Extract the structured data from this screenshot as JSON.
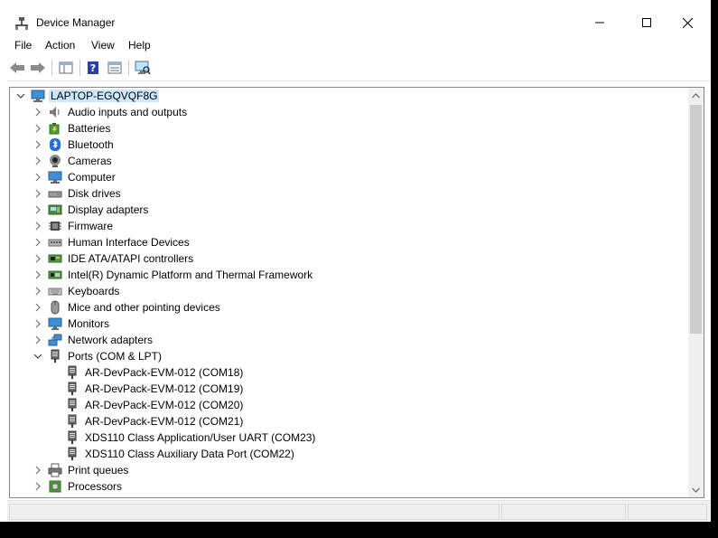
{
  "window": {
    "title": "Device Manager"
  },
  "menu": [
    "File",
    "Action",
    "View",
    "Help"
  ],
  "tree": {
    "root": "LAPTOP-EGQVQF8G",
    "categories": [
      {
        "label": "Audio inputs and outputs",
        "icon": "speaker-icon",
        "expanded": false
      },
      {
        "label": "Batteries",
        "icon": "battery-icon",
        "expanded": false
      },
      {
        "label": "Bluetooth",
        "icon": "bluetooth-icon",
        "expanded": false
      },
      {
        "label": "Cameras",
        "icon": "camera-icon",
        "expanded": false
      },
      {
        "label": "Computer",
        "icon": "computer-icon",
        "expanded": false
      },
      {
        "label": "Disk drives",
        "icon": "disk-drive-icon",
        "expanded": false
      },
      {
        "label": "Display adapters",
        "icon": "display-adapter-icon",
        "expanded": false
      },
      {
        "label": "Firmware",
        "icon": "firmware-icon",
        "expanded": false
      },
      {
        "label": "Human Interface Devices",
        "icon": "hid-icon",
        "expanded": false
      },
      {
        "label": "IDE ATA/ATAPI controllers",
        "icon": "ide-controller-icon",
        "expanded": false
      },
      {
        "label": "Intel(R) Dynamic Platform and Thermal Framework",
        "icon": "thermal-framework-icon",
        "expanded": false
      },
      {
        "label": "Keyboards",
        "icon": "keyboard-icon",
        "expanded": false
      },
      {
        "label": "Mice and other pointing devices",
        "icon": "mouse-icon",
        "expanded": false
      },
      {
        "label": "Monitors",
        "icon": "monitor-icon",
        "expanded": false
      },
      {
        "label": "Network adapters",
        "icon": "network-adapter-icon",
        "expanded": false
      },
      {
        "label": "Ports (COM & LPT)",
        "icon": "port-icon",
        "expanded": true,
        "children": [
          "AR-DevPack-EVM-012 (COM18)",
          "AR-DevPack-EVM-012 (COM19)",
          "AR-DevPack-EVM-012 (COM20)",
          "AR-DevPack-EVM-012 (COM21)",
          "XDS110 Class Application/User UART (COM23)",
          "XDS110 Class Auxiliary Data Port (COM22)"
        ]
      },
      {
        "label": "Print queues",
        "icon": "printer-icon",
        "expanded": false
      },
      {
        "label": "Processors",
        "icon": "processor-icon",
        "expanded": false
      }
    ]
  },
  "colors": {
    "selection": "#cce8ff",
    "pane_border": "#828790",
    "scrollbar_track": "#f0f0f0",
    "scrollbar_thumb": "#cdcdcd"
  }
}
